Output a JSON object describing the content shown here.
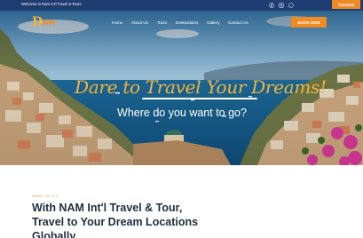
{
  "topbar": {
    "welcome": "Welcome to Nam Int'l Travel & Tours",
    "social_icons": [
      "facebook-icon",
      "instagram-icon",
      "whatsapp-icon"
    ],
    "translate_label": "Translate"
  },
  "header": {
    "logo_mark": "D",
    "logo_word": "AM",
    "nav": [
      "Home",
      "About Us",
      "Tours",
      "Destinations",
      "Gallery",
      "Contact Us"
    ],
    "book_label": "BOOK NOW"
  },
  "hero": {
    "tagline": "Dare to Travel Your Dreams!",
    "subhead": "Where do you want to go?"
  },
  "about": {
    "eyebrow": "DARE TO FLY",
    "line1": "With NAM Int'l Travel & Tour,",
    "line2": "Travel to Your Dream Locations",
    "line3": "Globally"
  },
  "colors": {
    "topbar": "#1f3d72",
    "accent": "#f08a24",
    "tagline": "#f2b43a"
  }
}
